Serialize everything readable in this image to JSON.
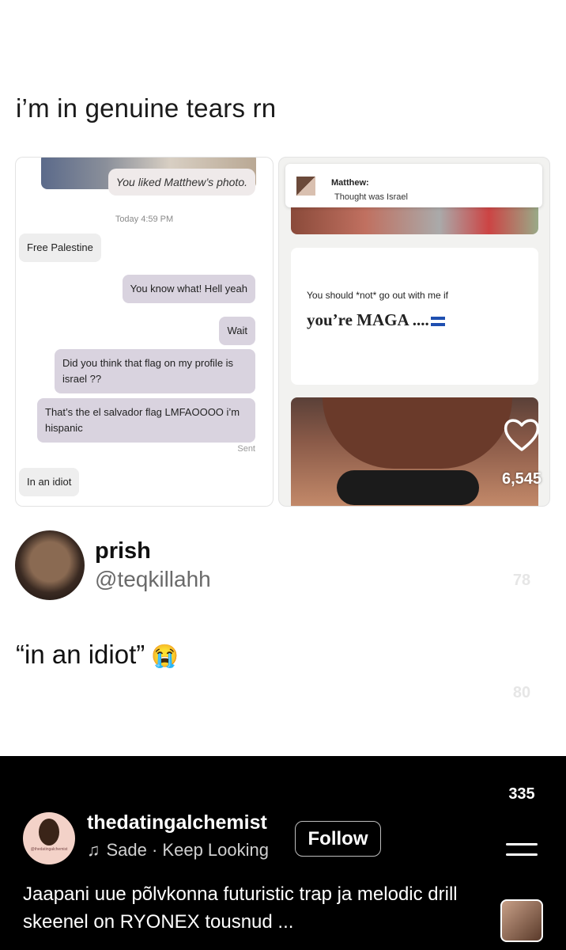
{
  "post": {
    "caption": "i’m in genuine tears rn",
    "chat": {
      "liked": "You liked Matthew’s photo.",
      "timestamp": "Today 4:59 PM",
      "messages": [
        {
          "dir": "in",
          "text": "Free Palestine"
        },
        {
          "dir": "out",
          "text": "You know what! Hell yeah"
        },
        {
          "dir": "out",
          "text": "Wait"
        },
        {
          "dir": "out",
          "text": "Did you think that flag on my profile is israel ??"
        },
        {
          "dir": "out",
          "text": "That’s the el salvador flag LMFAOOOO i’m hispanic"
        },
        {
          "dir": "in",
          "text": "In an idiot"
        }
      ],
      "status": "Sent"
    },
    "profile": {
      "notif_name": "Matthew:",
      "notif_msg": "Thought was Israel",
      "prompt_question": "You should *not* go out with me if",
      "prompt_answer": "you’re MAGA ....",
      "flag_colors": [
        "#1f4fb0",
        "#ffffff",
        "#1f4fb0"
      ]
    },
    "author": {
      "name": "prish",
      "handle": "@teqkillahh"
    },
    "tweet": {
      "text": "“in an idiot”",
      "emoji": "😭"
    }
  },
  "actions": {
    "likes": "6,545",
    "comments": "78",
    "reposts": "80",
    "shares": "335",
    "icons": [
      "heart-icon",
      "comment-icon",
      "repost-icon",
      "share-icon",
      "menu-icon"
    ]
  },
  "creator": {
    "username": "thedatingalchemist",
    "avatar_label": "@thedatingalchemist",
    "music": "Sade · Keep Looking",
    "follow_label": "Follow",
    "description": "Jaapani uue põlvkonna futuristic trap ja melodic drill skeenel on RYONEX tousnud ..."
  },
  "colors": {
    "bottom_bar": "#000000",
    "out_bubble": "#d9d3df",
    "in_bubble": "#eeeeee"
  }
}
